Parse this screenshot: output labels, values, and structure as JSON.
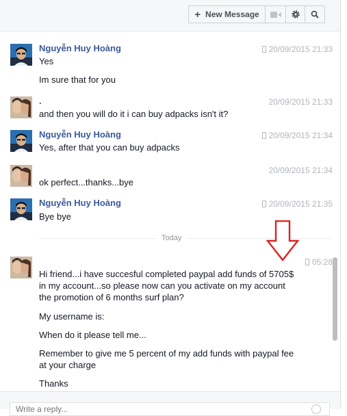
{
  "toolbar": {
    "new_message_label": "New Message",
    "plus_glyph": "+",
    "icons": [
      "video-camera-icon",
      "gear-icon",
      "search-icon"
    ]
  },
  "messages": [
    {
      "sender": "Nguyễn Huy Hoàng",
      "timestamp": "20/09/2015 21:33",
      "mobile": true,
      "lines": [
        "Yes",
        "Im sure that for you"
      ]
    },
    {
      "sender": ".",
      "timestamp": "20/09/2015 21:33",
      "mobile": false,
      "lines": [
        "and then you will do it i can buy adpacks isn't it?"
      ]
    },
    {
      "sender": "Nguyễn Huy Hoàng",
      "timestamp": "20/09/2015 21:34",
      "mobile": true,
      "lines": [
        "Yes, after that you can buy adpacks"
      ]
    },
    {
      "sender": "",
      "timestamp": "20/09/2015 21:34",
      "mobile": false,
      "lines": [
        "ok perfect...thanks...bye"
      ]
    },
    {
      "sender": "Nguyễn Huy Hoàng",
      "timestamp": "20/09/2015 21:35",
      "mobile": true,
      "lines": [
        "Bye bye"
      ]
    }
  ],
  "divider_label": "Today",
  "today_message": {
    "timestamp": "05:28",
    "mobile": true,
    "paragraphs": [
      "Hi friend...i have succesful completed paypal add funds of 5705$\nin my account...so please now can you activate on my account\nthe promotion of 6 months surf plan?",
      "My username is:",
      "When do it please tell me...",
      "Remember to give me 5 percent of my add funds with paypal fee\nat your charge",
      "Thanks"
    ]
  },
  "composer": {
    "placeholder": "Write a reply..."
  },
  "colors": {
    "sender_name": "#3b5998",
    "annotation_arrow": "#e02020",
    "timestamp": "#b0b4bc"
  }
}
